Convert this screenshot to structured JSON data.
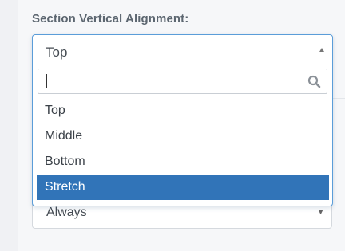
{
  "section": {
    "label": "Section Vertical Alignment:"
  },
  "alignment_select": {
    "value": "Top",
    "search_placeholder": "",
    "options": [
      "Top",
      "Middle",
      "Bottom",
      "Stretch"
    ],
    "highlighted": "Stretch"
  },
  "second_select": {
    "value": "Always"
  },
  "colors": {
    "highlight": "#3174b8",
    "focus_border": "#5b9dd9",
    "label_text": "#5c6670"
  },
  "icons": {
    "dropdown_open": "chevron-up-icon",
    "dropdown_closed": "chevron-down-icon",
    "search": "search-icon"
  }
}
